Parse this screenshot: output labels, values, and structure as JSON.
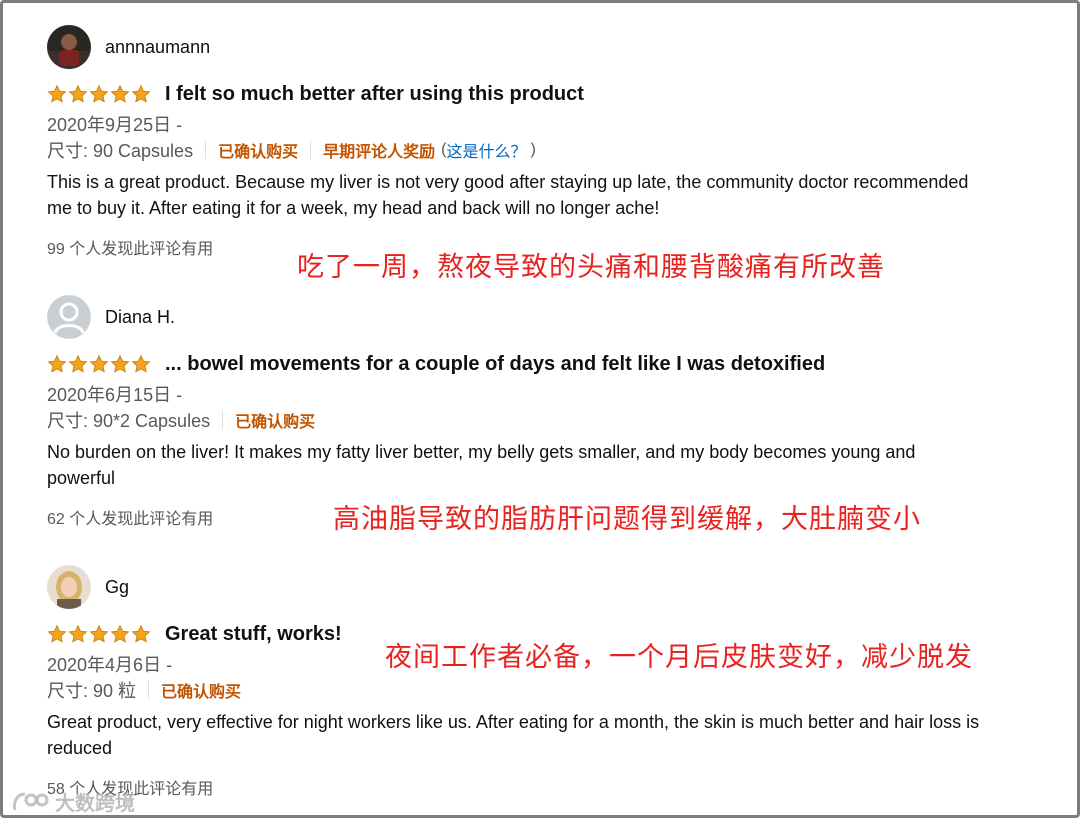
{
  "reviews": [
    {
      "username": "annnaumann",
      "title": "I felt so much better after using this product",
      "date": "2020年9月25日 -",
      "size": "尺寸: 90 Capsules",
      "verified": "已确认购买",
      "early_reviewer": "早期评论人奖励",
      "whats_this_open": "(",
      "whats_this": "这是什么？",
      "whats_this_close": ")",
      "body": "This is a great product. Because my liver is not very good after staying up late, the community doctor recommended me to buy it. After eating it for a week, my head and back will no longer ache!",
      "helpful": "99 个人发现此评论有用",
      "annotation": "吃了一周，熬夜导致的头痛和腰背酸痛有所改善",
      "rating": 5
    },
    {
      "username": "Diana H.",
      "title": "... bowel movements for a couple of days and felt like I was detoxified",
      "date": "2020年6月15日 -",
      "size": "尺寸: 90*2 Capsules",
      "verified": "已确认购买",
      "body": "No burden on the liver! It makes my fatty liver better, my belly gets smaller, and my body becomes young and powerful",
      "helpful": "62 个人发现此评论有用",
      "annotation": "高油脂导致的脂肪肝问题得到缓解，大肚腩变小",
      "rating": 5
    },
    {
      "username": "Gg",
      "title": "Great stuff, works!",
      "date": "2020年4月6日 -",
      "size": "尺寸: 90 粒",
      "verified": "已确认购买",
      "body": "Great product, very effective for night workers like us. After eating for a month, the skin is much better and hair loss is reduced",
      "helpful": "58 个人发现此评论有用",
      "annotation": "夜间工作者必备，一个月后皮肤变好，减少脱发",
      "rating": 5
    }
  ],
  "watermark": "大数跨境",
  "colors": {
    "star": "#f4a41c",
    "verified": "#c45500",
    "link": "#0066c0",
    "annotation": "#e8231f",
    "meta": "#565959"
  }
}
